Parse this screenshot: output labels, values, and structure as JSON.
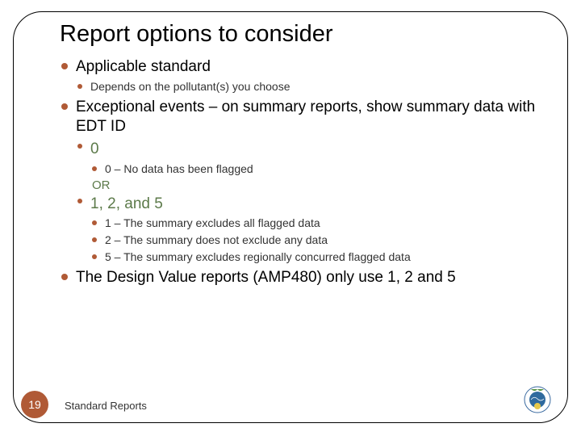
{
  "title": "Report options to consider",
  "bullets": {
    "b1": {
      "label": "Applicable standard",
      "sub": [
        "Depends on the pollutant(s) you choose"
      ]
    },
    "b2": {
      "label": "Exceptional events – on summary reports, show summary data with EDT ID",
      "opt0": {
        "label": "0",
        "sub": [
          "0 – No data has been flagged"
        ]
      },
      "or": "OR",
      "opt125": {
        "label": "1, 2, and 5",
        "sub": [
          "1 – The summary excludes all flagged data",
          "2 – The summary does not exclude any data",
          "5 – The summary excludes regionally concurred flagged data"
        ]
      }
    },
    "b3": {
      "label": "The Design Value reports (AMP480) only use 1, 2 and 5"
    }
  },
  "footer": {
    "page": "19",
    "label": "Standard Reports"
  }
}
